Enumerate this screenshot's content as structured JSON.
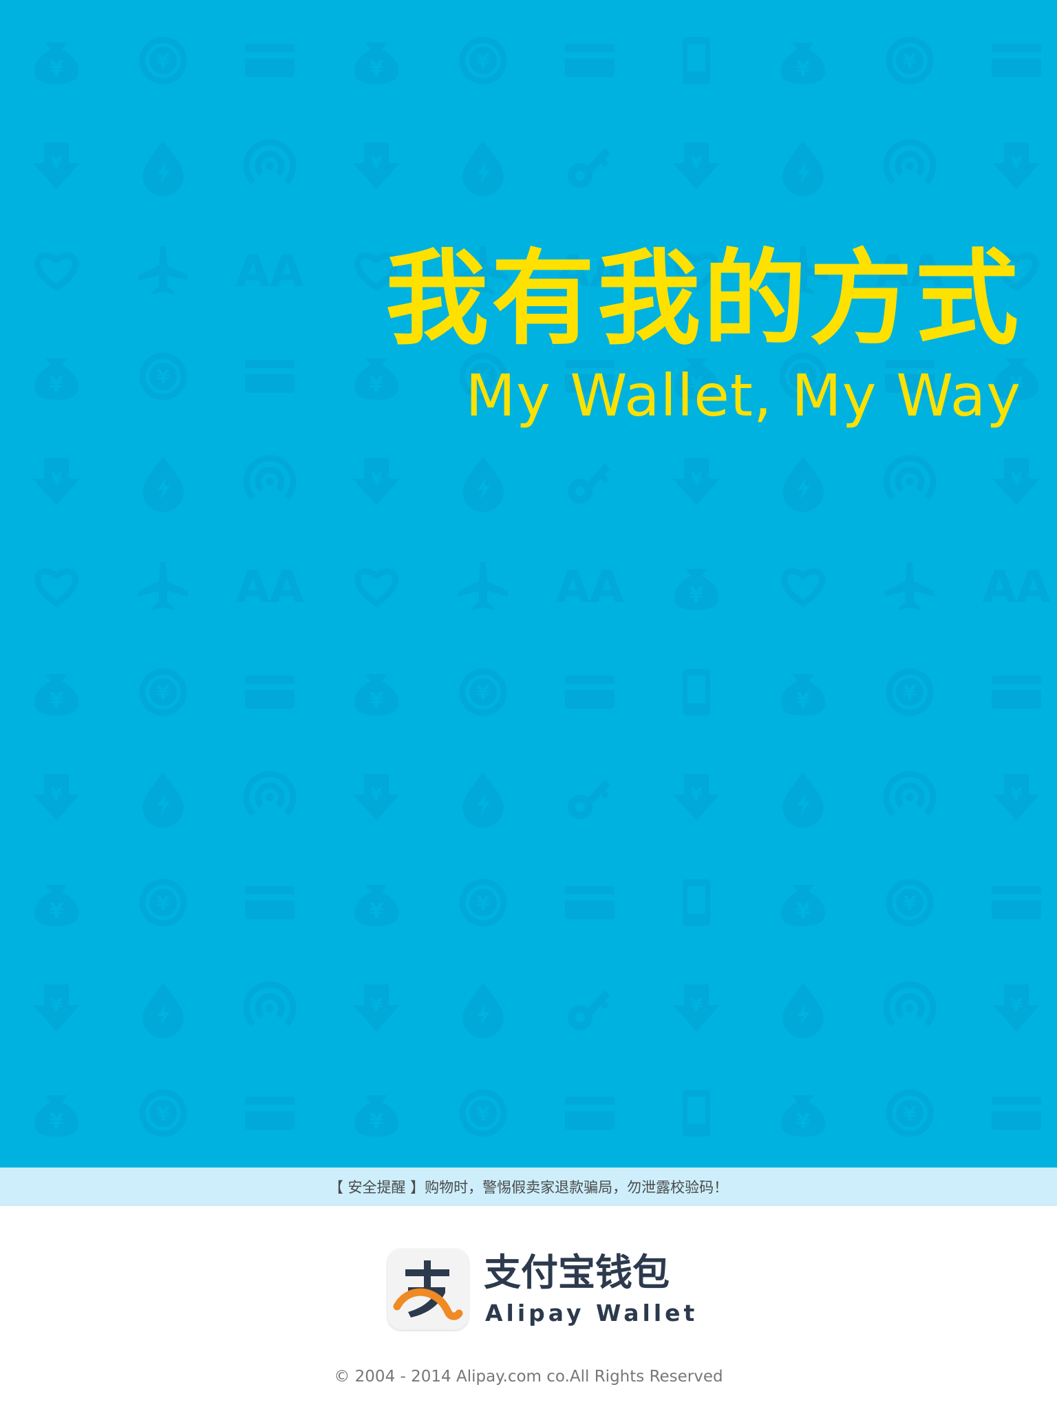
{
  "hero": {
    "title_cn": "我有我的方式",
    "title_en": "My Wallet, My Way",
    "background_color": "#00b2e0",
    "title_color": "#ffe100",
    "pattern_icons": [
      "money-bag-icon",
      "yen-coin-icon",
      "bank-card-icon",
      "yen-down-arrow-icon",
      "drop-bolt-icon",
      "signal-icon",
      "heart-icon",
      "airplane-icon",
      "aa-split-icon",
      "phone-icon",
      "key-icon"
    ]
  },
  "notice": {
    "text": "【 安全提醒 】购物时，警惕假卖家退款骗局，勿泄露校验码！",
    "background_color": "#cdeefa"
  },
  "brand": {
    "name_cn": "支付宝钱包",
    "name_en": "Alipay Wallet",
    "icon": "alipay-logo-icon",
    "text_color": "#2d3a4d",
    "accent_color": "#f08a24"
  },
  "footer": {
    "copyright": "© 2004 - 2014 Alipay.com co.All Rights Reserved"
  }
}
